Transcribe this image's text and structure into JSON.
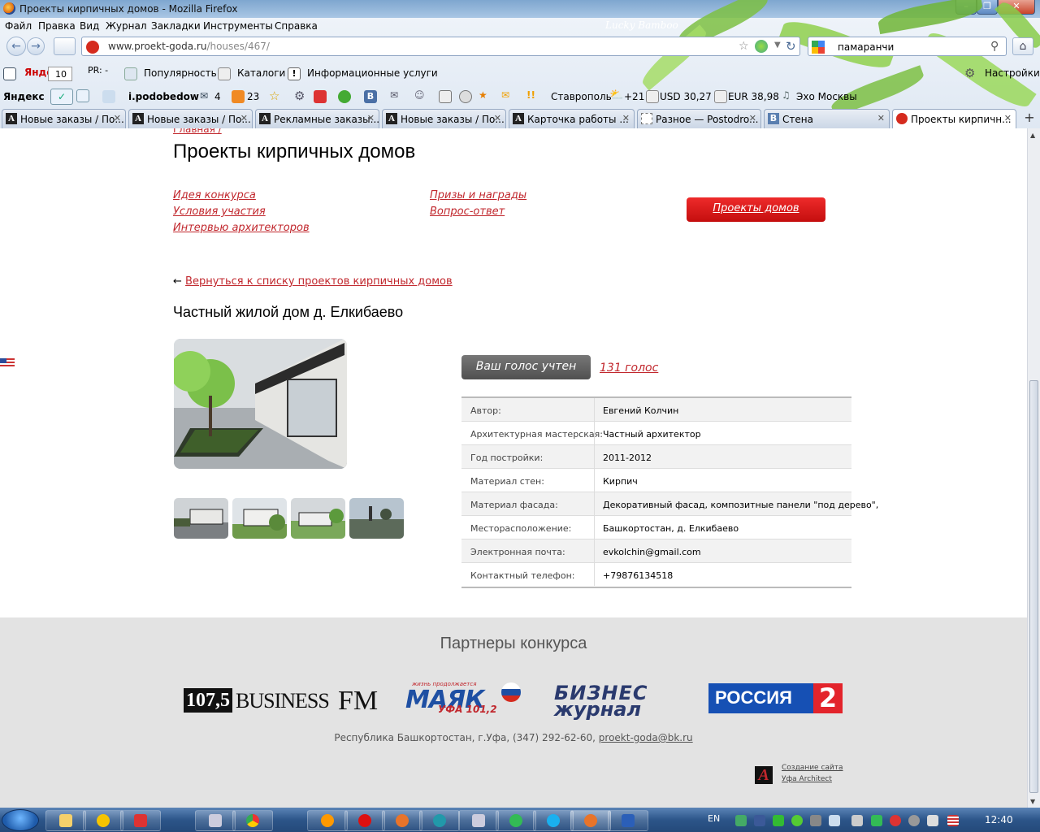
{
  "window": {
    "title": "Проекты кирпичных домов - Mozilla Firefox"
  },
  "menu": [
    "Файл",
    "Правка",
    "Вид",
    "Журнал",
    "Закладки",
    "Инструменты",
    "Справка"
  ],
  "theme_name": "Lucky Bamboo",
  "urlbar": {
    "domain": "www.proekt-goda.ru",
    "path": "/houses/467/"
  },
  "search": {
    "value": "памаранчи"
  },
  "yandex_bar": {
    "yandex": "Яндекс",
    "yic_label": "Яиц:",
    "yic_value": "10",
    "pr_label": "PR: -",
    "popularity": "Популярность",
    "catalogs": "Каталоги",
    "info": "Информационные услуги",
    "settings": "Настройки"
  },
  "toolbar2": {
    "brand": "Яндекс",
    "user": "i.podobedow",
    "mail_count": "4",
    "count23": "23",
    "city": "Ставрополь",
    "temp": "+21",
    "usd": "USD 30,27",
    "eur": "EUR 38,98",
    "radio": "Эхо Москвы"
  },
  "tabs": [
    {
      "label": "Новые заказы / По...",
      "icon": "A"
    },
    {
      "label": "Новые заказы / По...",
      "icon": "A"
    },
    {
      "label": "Рекламные заказы...",
      "icon": "A"
    },
    {
      "label": "Новые заказы / По...",
      "icon": "A"
    },
    {
      "label": "Карточка работы ...",
      "icon": "A"
    },
    {
      "label": "Разное — Postodro...",
      "icon": ""
    },
    {
      "label": "Стена",
      "icon": "В"
    },
    {
      "label": "Проекты кирпичн...",
      "icon": ""
    }
  ],
  "page": {
    "breadcrumb": "Главная /",
    "title": "Проекты кирпичных домов",
    "nav_left": [
      "Идея конкурса",
      "Условия участия",
      "Интервью архитекторов"
    ],
    "nav_mid": [
      "Призы и награды",
      "Вопрос-ответ"
    ],
    "projects_button": "Проекты домов",
    "back_arrow": "←",
    "back_link": "Вернуться к списку проектов кирпичных домов",
    "house_title": "Частный жилой дом д. Елкибаево",
    "vote_button": "Ваш голос учтен",
    "vote_count": "131 голос",
    "info": [
      {
        "k": "Автор:",
        "v": "Евгений Колчин"
      },
      {
        "k": "Архитектурная мастерская:",
        "v": "Частный архитектор"
      },
      {
        "k": "Год постройки:",
        "v": "2011-2012"
      },
      {
        "k": "Материал стен:",
        "v": "Кирпич"
      },
      {
        "k": "Материал фасада:",
        "v": "Декоративный фасад, композитные панели \"под дерево\","
      },
      {
        "k": "Месторасположение:",
        "v": "Башкортостан, д. Елкибаево"
      },
      {
        "k": "Электронная почта:",
        "v": "evkolchin@gmail.com"
      },
      {
        "k": "Контактный телефон:",
        "v": "+79876134518"
      }
    ]
  },
  "footer": {
    "partners_title": "Партнеры конкурса",
    "logo1": {
      "num": "107,5",
      "word": "BUSINESS",
      "fm": "FM"
    },
    "logo2": {
      "small": "жизнь продолжается",
      "big": "МАЯК",
      "sub": "УФА 101,2"
    },
    "logo3": {
      "a": "БИЗНЕС",
      "b": "журнал"
    },
    "logo4": {
      "t": "РОССИЯ",
      "n": "2"
    },
    "address": "Республика Башкортостан, г.Уфа, (347) 292-62-60, ",
    "email": "proekt-goda@bk.ru",
    "dev_line1": "Создание сайта",
    "dev_line2": "Уфа Architect"
  },
  "taskbar": {
    "lang": "EN",
    "clock": "12:40"
  },
  "colors": {
    "accent_red": "#c1272d",
    "button_red": "#e11b1b",
    "footer_bg": "#e3e3e3"
  }
}
